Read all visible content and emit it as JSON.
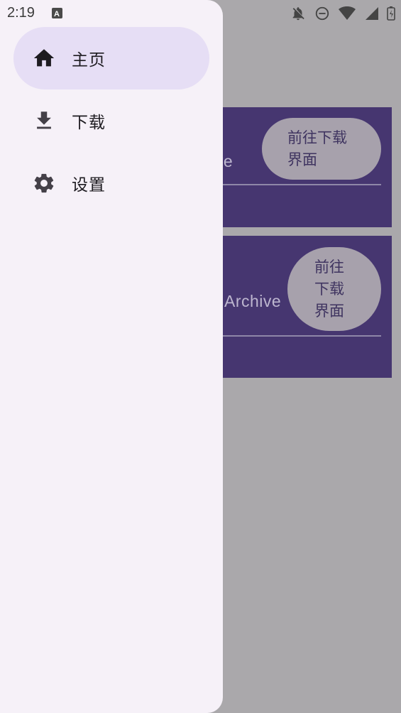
{
  "status_bar": {
    "time": "2:19",
    "icons": [
      "text-app-icon",
      "notifications-off-icon",
      "do-not-disturb-icon",
      "wifi-icon",
      "cellular-signal-icon",
      "battery-charging-icon"
    ]
  },
  "drawer": {
    "items": [
      {
        "label": "主页",
        "icon": "home-icon",
        "selected": true
      },
      {
        "label": "下载",
        "icon": "download-icon",
        "selected": false
      },
      {
        "label": "设置",
        "icon": "settings-icon",
        "selected": false
      }
    ]
  },
  "background": {
    "cards": [
      {
        "title": "chive",
        "button_label": "前往下载界面"
      },
      {
        "title": "Archive",
        "button_label": "前往下载界面"
      }
    ]
  },
  "colors": {
    "drawer_bg": "#f6f1f8",
    "selected_item_bg": "#e6def5",
    "card_bg": "#463670",
    "scrim": "#aaa8ab"
  }
}
